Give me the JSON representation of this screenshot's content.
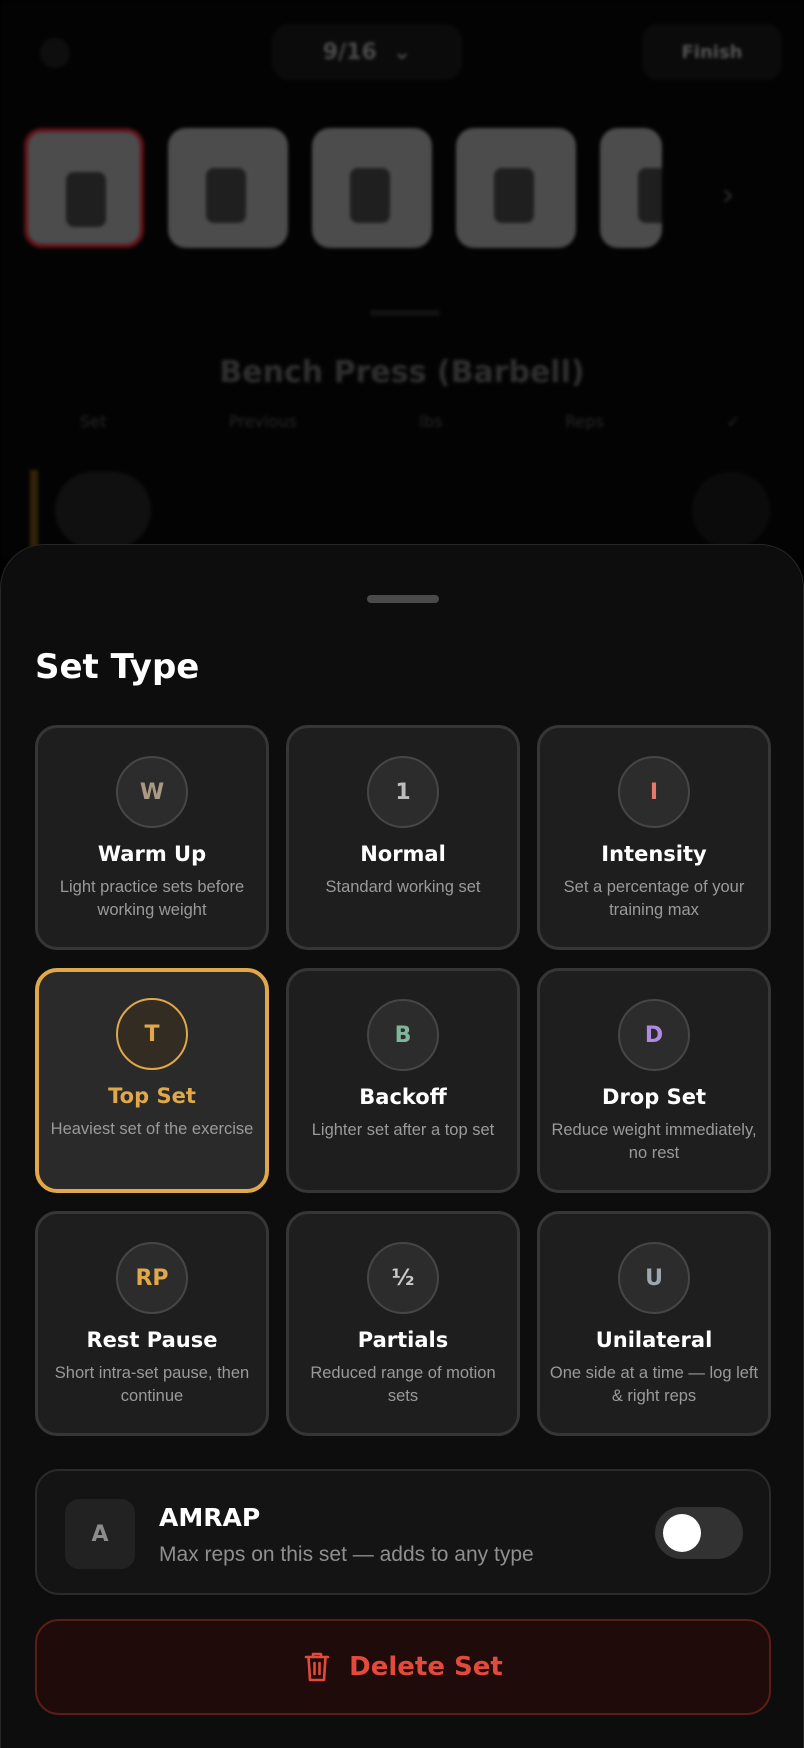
{
  "background": {
    "date_label": "9/16",
    "date_chevron": "⌄",
    "finish_label": "Finish",
    "exercise_title": "Bench Press (Barbell)",
    "column_headers": [
      "Set",
      "Previous",
      "lbs",
      "Reps",
      "✓"
    ]
  },
  "sheet": {
    "title": "Set Type",
    "set_types": [
      {
        "code": "W",
        "label": "Warm Up",
        "description": "Light practice sets before working weight",
        "color": "#a89a84",
        "selected": false
      },
      {
        "code": "1",
        "label": "Normal",
        "description": "Standard working set",
        "color": "#bdbdbd",
        "selected": false
      },
      {
        "code": "I",
        "label": "Intensity",
        "description": "Set a percentage of your training max",
        "color": "#e8776c",
        "selected": false
      },
      {
        "code": "T",
        "label": "Top Set",
        "description": "Heaviest set of the exercise",
        "color": "#e0a84a",
        "selected": true
      },
      {
        "code": "B",
        "label": "Backoff",
        "description": "Lighter set after a top set",
        "color": "#7fb59a",
        "selected": false
      },
      {
        "code": "D",
        "label": "Drop Set",
        "description": "Reduce weight immediately, no rest",
        "color": "#b08ae0",
        "selected": false
      },
      {
        "code": "RP",
        "label": "Rest Pause",
        "description": "Short intra-set pause, then continue",
        "color": "#e0a84a",
        "selected": false
      },
      {
        "code": "½",
        "label": "Partials",
        "description": "Reduced range of motion sets",
        "color": "#c9c9c9",
        "selected": false
      },
      {
        "code": "U",
        "label": "Unilateral",
        "description": "One side at a time — log left & right reps",
        "color": "#9ea6b0",
        "selected": false
      }
    ],
    "amrap": {
      "badge": "A",
      "title": "AMRAP",
      "description": "Max reps on this set — adds to any type",
      "enabled": false
    },
    "delete_label": "Delete Set"
  }
}
